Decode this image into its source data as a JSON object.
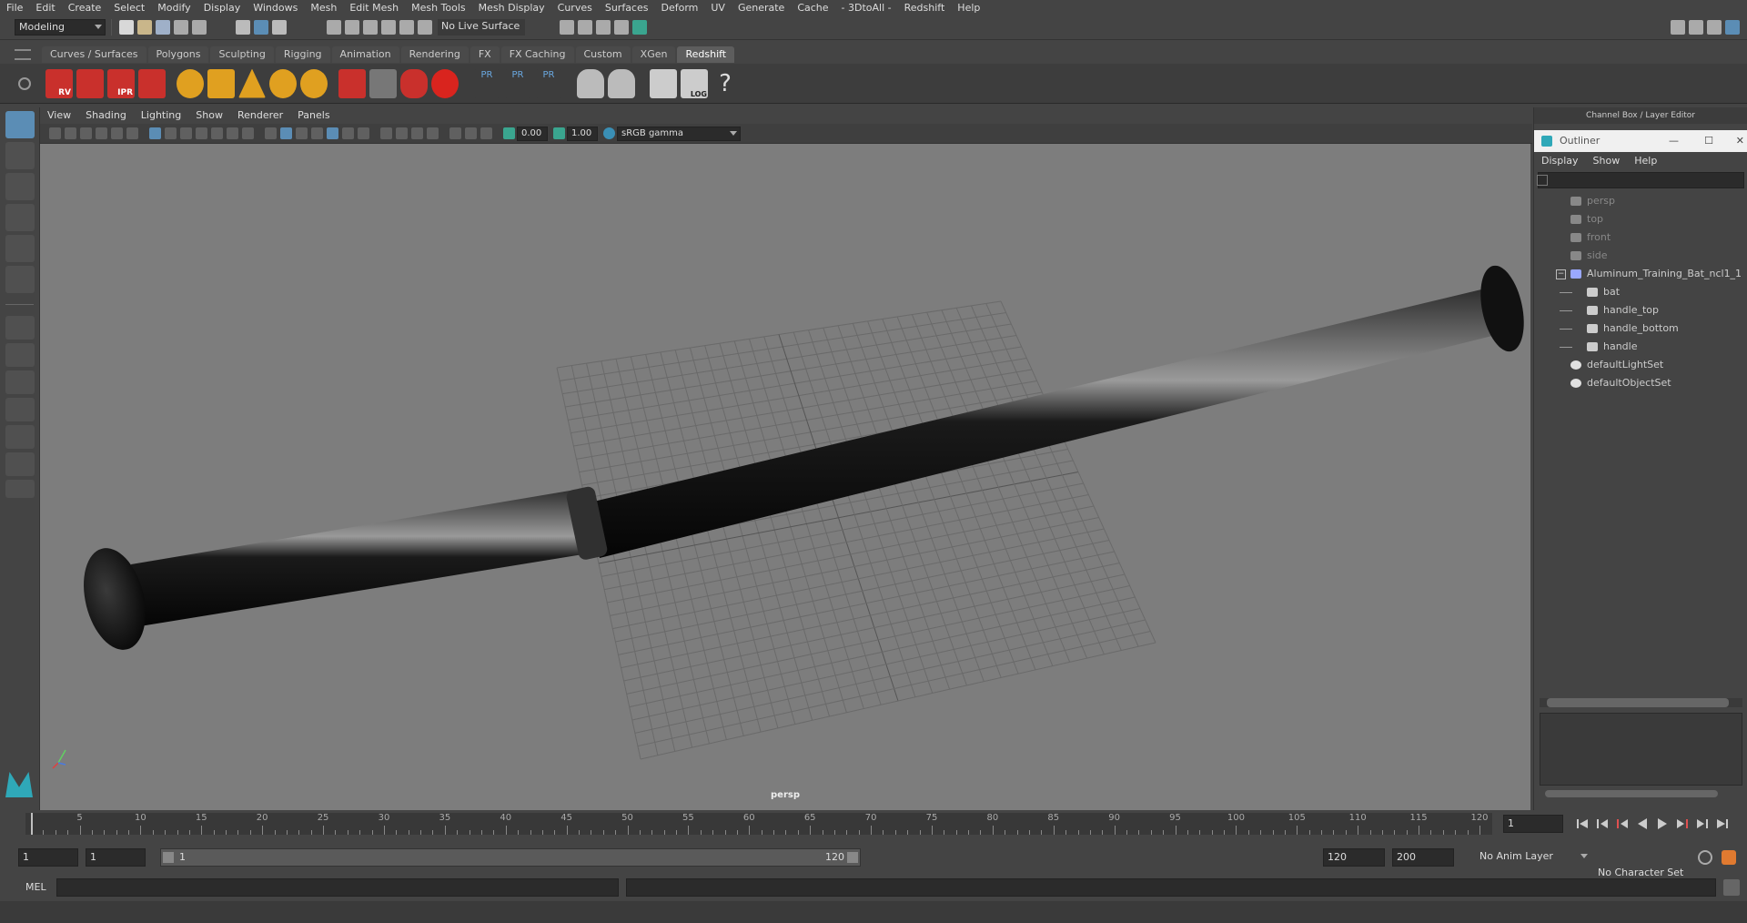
{
  "menubar": [
    "File",
    "Edit",
    "Create",
    "Select",
    "Modify",
    "Display",
    "Windows",
    "Mesh",
    "Edit Mesh",
    "Mesh Tools",
    "Mesh Display",
    "Curves",
    "Surfaces",
    "Deform",
    "UV",
    "Generate",
    "Cache",
    "- 3DtoAll -",
    "Redshift",
    "Help"
  ],
  "status": {
    "mode": "Modeling",
    "live_surface": "No Live Surface"
  },
  "shelf_tabs": [
    "Curves / Surfaces",
    "Polygons",
    "Sculpting",
    "Rigging",
    "Animation",
    "Rendering",
    "FX",
    "FX Caching",
    "Custom",
    "XGen",
    "Redshift"
  ],
  "active_shelf": "Redshift",
  "shelf_labels": {
    "rv": "RV",
    "ipr": "IPR",
    "pr1": "PR",
    "pr2": "PR",
    "pr3": "PR",
    "log": "LOG",
    "help": "?"
  },
  "viewport_menu": [
    "View",
    "Shading",
    "Lighting",
    "Show",
    "Renderer",
    "Panels"
  ],
  "viewport_toolbar": {
    "exposure": "0.00",
    "gamma": "1.00",
    "colorspace": "sRGB gamma"
  },
  "camera_label": "persp",
  "right_panel_title": "Channel Box / Layer Editor",
  "outliner": {
    "title": "Outliner",
    "menu": [
      "Display",
      "Show",
      "Help"
    ],
    "items": [
      {
        "label": "persp",
        "type": "camera",
        "depth": 0,
        "dim": true
      },
      {
        "label": "top",
        "type": "camera",
        "depth": 0,
        "dim": true
      },
      {
        "label": "front",
        "type": "camera",
        "depth": 0,
        "dim": true
      },
      {
        "label": "side",
        "type": "camera",
        "depth": 0,
        "dim": true
      },
      {
        "label": "Aluminum_Training_Bat_ncl1_1",
        "type": "group",
        "depth": 0,
        "dim": false
      },
      {
        "label": "bat",
        "type": "mesh",
        "depth": 1,
        "dim": false
      },
      {
        "label": "handle_top",
        "type": "mesh",
        "depth": 1,
        "dim": false
      },
      {
        "label": "handle_bottom",
        "type": "mesh",
        "depth": 1,
        "dim": false
      },
      {
        "label": "handle",
        "type": "mesh",
        "depth": 1,
        "dim": false
      },
      {
        "label": "defaultLightSet",
        "type": "set",
        "depth": 0,
        "dim": false
      },
      {
        "label": "defaultObjectSet",
        "type": "set",
        "depth": 0,
        "dim": false
      }
    ]
  },
  "timeline": {
    "start": 1,
    "end": 120,
    "current_frame": "1",
    "ticks": [
      5,
      10,
      15,
      20,
      25,
      30,
      35,
      40,
      45,
      50,
      55,
      60,
      65,
      70,
      75,
      80,
      85,
      90,
      95,
      100,
      105,
      110,
      115,
      120
    ]
  },
  "range": {
    "start_field": "1",
    "playback_start": "1",
    "range_start_label": "1",
    "range_end_label": "120",
    "playback_end": "120",
    "anim_end": "200",
    "anim_layer": "No Anim Layer",
    "character_set": "No Character Set"
  },
  "cmdline": {
    "lang": "MEL"
  },
  "colors": {
    "accent": "#5b8db5",
    "viewport_bg": "#7d7d7d",
    "redshift_red": "#c9302c"
  }
}
